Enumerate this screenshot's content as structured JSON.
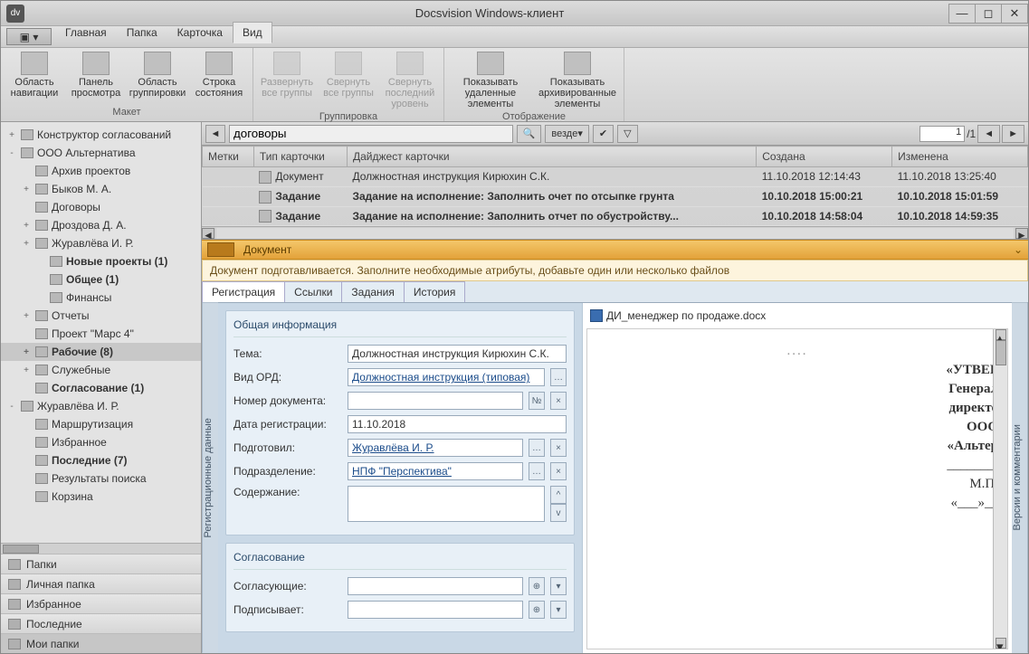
{
  "window": {
    "title": "Docsvision Windows-клиент",
    "icon_label": "dv"
  },
  "menubar": {
    "tabs": [
      "Главная",
      "Папка",
      "Карточка",
      "Вид"
    ],
    "active_index": 3
  },
  "ribbon": {
    "groups": [
      {
        "title": "Макет",
        "items": [
          {
            "label": "Область навигации"
          },
          {
            "label": "Панель просмотра"
          },
          {
            "label": "Область группировки"
          },
          {
            "label": "Строка состояния"
          }
        ]
      },
      {
        "title": "Группировка",
        "items": [
          {
            "label": "Развернуть все группы",
            "disabled": true
          },
          {
            "label": "Свернуть все группы",
            "disabled": true
          },
          {
            "label": "Свернуть последний уровень",
            "disabled": true
          }
        ]
      },
      {
        "title": "Отображение",
        "items": [
          {
            "label": "Показывать удаленные элементы",
            "wide": true
          },
          {
            "label": "Показывать архивированные элементы",
            "wide": true
          }
        ]
      }
    ]
  },
  "tree": [
    {
      "lvl": 1,
      "exp": "+",
      "label": "Конструктор согласований"
    },
    {
      "lvl": 1,
      "exp": "-",
      "label": "ООО Альтернатива"
    },
    {
      "lvl": 2,
      "exp": "",
      "label": "Архив проектов"
    },
    {
      "lvl": 2,
      "exp": "+",
      "label": "Быков М. А."
    },
    {
      "lvl": 2,
      "exp": "",
      "label": "Договоры"
    },
    {
      "lvl": 2,
      "exp": "+",
      "label": "Дроздова Д. А."
    },
    {
      "lvl": 2,
      "exp": "+",
      "label": "Журавлёва И. Р."
    },
    {
      "lvl": 3,
      "exp": "",
      "label": "Новые проекты  (1)",
      "bold": true
    },
    {
      "lvl": 3,
      "exp": "",
      "label": "Общее  (1)",
      "bold": true
    },
    {
      "lvl": 3,
      "exp": "",
      "label": "Финансы"
    },
    {
      "lvl": 2,
      "exp": "+",
      "label": "Отчеты"
    },
    {
      "lvl": 2,
      "exp": "",
      "label": "Проект \"Марс 4\""
    },
    {
      "lvl": 2,
      "exp": "+",
      "label": "Рабочие  (8)",
      "bold": true,
      "sel": true
    },
    {
      "lvl": 2,
      "exp": "+",
      "label": "Служебные"
    },
    {
      "lvl": 2,
      "exp": "",
      "label": "Согласование  (1)",
      "bold": true
    },
    {
      "lvl": 1,
      "exp": "-",
      "label": "Журавлёва И. Р."
    },
    {
      "lvl": 2,
      "exp": "",
      "label": "Маршрутизация"
    },
    {
      "lvl": 2,
      "exp": "",
      "label": "Избранное"
    },
    {
      "lvl": 2,
      "exp": "",
      "label": "Последние  (7)",
      "bold": true
    },
    {
      "lvl": 2,
      "exp": "",
      "label": "Результаты поиска"
    },
    {
      "lvl": 2,
      "exp": "",
      "label": "Корзина"
    }
  ],
  "nav_footer": [
    "Папки",
    "Личная папка",
    "Избранное",
    "Последние",
    "Мои папки"
  ],
  "searchbar": {
    "query": "договоры",
    "scope": "везде",
    "page": "1",
    "page_total": "/1"
  },
  "grid": {
    "columns": [
      "Метки",
      "Тип карточки",
      "Дайджест карточки",
      "Создана",
      "Изменена"
    ],
    "rows": [
      {
        "type": "Документ",
        "digest": "Должностная инструкция Кирюхин С.К.",
        "created": "11.10.2018 12:14:43",
        "modified": "11.10.2018 13:25:40",
        "sel": true,
        "bold": false
      },
      {
        "type": "Задание",
        "digest": "Задание на исполнение: Заполнить очет по отсыпке грунта",
        "created": "10.10.2018 15:00:21",
        "modified": "10.10.2018 15:01:59",
        "bold": true
      },
      {
        "type": "Задание",
        "digest": "Задание на исполнение: Заполнить отчет по обустройству...",
        "created": "10.10.2018 14:58:04",
        "modified": "10.10.2018 14:59:35",
        "bold": true
      }
    ]
  },
  "cardbar": {
    "title": "Документ"
  },
  "notice": "Документ подготавливается. Заполните необходимые атрибуты, добавьте один или несколько файлов",
  "card_tabs": [
    "Регистрация",
    "Ссылки",
    "Задания",
    "История"
  ],
  "form": {
    "group1_title": "Общая информация",
    "tema_label": "Тема:",
    "tema_value": "Должностная инструкция Кирюхин С.К.",
    "vid_label": "Вид ОРД:",
    "vid_value": "Должностная инструкция (типовая)",
    "nomer_label": "Номер документа:",
    "nomer_btn": "№",
    "data_label": "Дата регистрации:",
    "data_value": "11.10.2018",
    "podgotovil_label": "Подготовил:",
    "podgotovil_value": "Журавлёва И. Р.",
    "podrazd_label": "Подразделение:",
    "podrazd_value": "НПФ \"Перспектива\"",
    "soderzh_label": "Содержание:",
    "group2_title": "Согласование",
    "sogl_label": "Согласующие:",
    "podpis_label": "Подписывает:"
  },
  "vstrip_left": "Регистрационные данные",
  "vstrip_right": "Версии и комментарии",
  "file_name": "ДИ_менеджер по продаже.docx",
  "preview": {
    "lines": [
      "«УТВЕР",
      "Генерал",
      "директо",
      "ООО",
      "«Альтер",
      "",
      "_______/",
      "",
      "М.П.",
      "",
      "«___»__"
    ]
  }
}
